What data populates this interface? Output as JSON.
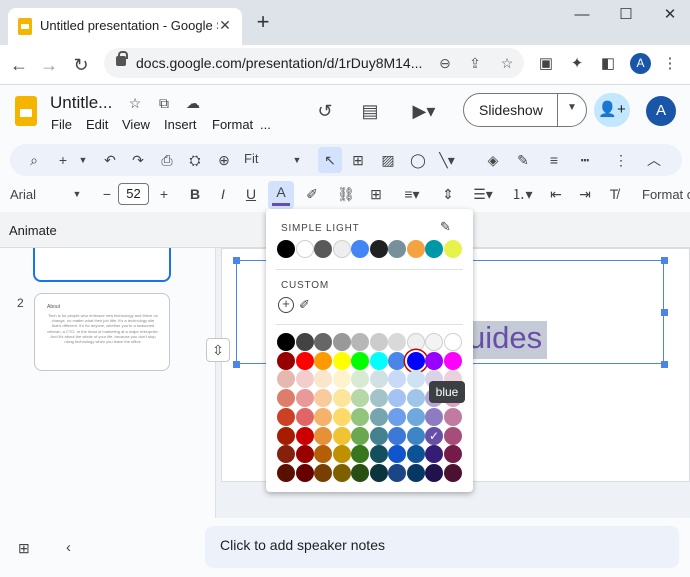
{
  "browser": {
    "tab_title": "Untitled presentation - Google Slides",
    "url": "docs.google.com/presentation/d/1rDuy8M14...",
    "profile_initial": "A",
    "window_controls": [
      "minimize-icon",
      "maximize-icon",
      "close-icon"
    ]
  },
  "app": {
    "doc_title": "Untitle...",
    "menus": [
      "File",
      "Edit",
      "View",
      "Insert",
      "Format",
      "..."
    ],
    "slideshow_label": "Slideshow",
    "profile_initial": "A"
  },
  "toolbar": {
    "zoom_label": "Fit",
    "font_name": "Arial",
    "font_size": "52",
    "format_options_label": "Format o",
    "animate_label": "Animate"
  },
  "filmstrip": {
    "slide2_number": "2",
    "slide2_heading": "About",
    "slide2_body": "Tech is for people who embrace new technology and thrive on change, no matter what their job title. It's a technology site that's different. It's for anyone, whether you're a seasoned veteran, a CTO, or the head of marketing at a major enterprise. And it's about the whole of your life, because you don't stop using technology when you leave the office."
  },
  "canvas": {
    "slide_text": "uides",
    "text_color": "#674ea7",
    "selection_color": "#4a86e8"
  },
  "notes": {
    "placeholder": "Click to add speaker notes"
  },
  "color_menu": {
    "theme_label": "SIMPLE LIGHT",
    "custom_label": "CUSTOM",
    "tooltip": "blue",
    "selected_color": "#0000ff",
    "checked_color": "#674ea7",
    "theme_colors": [
      "#000000",
      "#ffffff",
      "#595959",
      "#eeeeee",
      "#4285f4",
      "#212121",
      "#78909c",
      "#f4a340",
      "#0097a7",
      "#e6f34a"
    ],
    "standard_rows": [
      [
        "#000000",
        "#434343",
        "#666666",
        "#999999",
        "#b7b7b7",
        "#cccccc",
        "#d9d9d9",
        "#efefef",
        "#f3f3f3",
        "#ffffff"
      ],
      [
        "#980000",
        "#ff0000",
        "#ff9900",
        "#ffff00",
        "#00ff00",
        "#00ffff",
        "#4a86e8",
        "#0000ff",
        "#9900ff",
        "#ff00ff"
      ],
      [
        "#e6b8af",
        "#f4cccc",
        "#fce5cd",
        "#fff2cc",
        "#d9ead3",
        "#d0e0e3",
        "#c9daf8",
        "#cfe2f3",
        "#d9d2e9",
        "#ead1dc"
      ],
      [
        "#dd7e6b",
        "#ea9999",
        "#f9cb9c",
        "#ffe599",
        "#b6d7a8",
        "#a2c4c9",
        "#a4c2f4",
        "#9fc5e8",
        "#b4a7d6",
        "#d5a6bd"
      ],
      [
        "#cc4125",
        "#e06666",
        "#f6b26b",
        "#ffd966",
        "#93c47d",
        "#76a5af",
        "#6d9eeb",
        "#6fa8dc",
        "#8e7cc3",
        "#c27ba0"
      ],
      [
        "#a61c00",
        "#cc0000",
        "#e69138",
        "#f1c232",
        "#6aa84f",
        "#45818e",
        "#3c78d8",
        "#3d85c6",
        "#674ea7",
        "#a64d79"
      ],
      [
        "#85200c",
        "#990000",
        "#b45f06",
        "#bf9000",
        "#38761d",
        "#134f5c",
        "#1155cc",
        "#0b5394",
        "#351c75",
        "#741b47"
      ],
      [
        "#5b0f00",
        "#660000",
        "#783f04",
        "#7f6000",
        "#274e13",
        "#0c343d",
        "#1c4587",
        "#073763",
        "#20124d",
        "#4c1130"
      ]
    ]
  }
}
